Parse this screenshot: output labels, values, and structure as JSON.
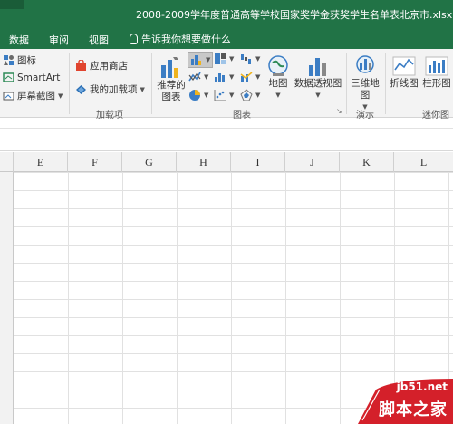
{
  "window": {
    "title": "2008-2009学年度普通高等学校国家奖学金获奖学生名单表北京市.xlsx  -  Excel"
  },
  "menu": {
    "tabs": [
      "数据",
      "审阅",
      "视图"
    ],
    "tell_me": "告诉我你想要做什么"
  },
  "ribbon": {
    "illustrations": {
      "icons_label": "图标",
      "smartart_label": "SmartArt",
      "screenshot_label": "屏幕截图"
    },
    "addins": {
      "store_label": "应用商店",
      "my_addins_label": "我的加载项",
      "group_label": "加载项"
    },
    "charts": {
      "recommended_line1": "推荐的",
      "recommended_line2": "图表",
      "maps_label": "地图",
      "pivot_chart_label": "数据透视图",
      "group_label": "图表"
    },
    "tours": {
      "map3d_line1": "三维地",
      "map3d_line2": "图",
      "group_label": "演示"
    },
    "sparklines": {
      "line_label": "折线图",
      "column_label": "柱形图",
      "group_label": "迷你图"
    }
  },
  "grid": {
    "columns": [
      "E",
      "F",
      "G",
      "H",
      "I",
      "J",
      "K",
      "L"
    ]
  },
  "watermark": {
    "url": "jb51.net",
    "name": "脚本之家"
  },
  "colors": {
    "excel_green": "#217346",
    "ribbon_bg": "#f3f3f3",
    "watermark_red": "#d4202a"
  }
}
